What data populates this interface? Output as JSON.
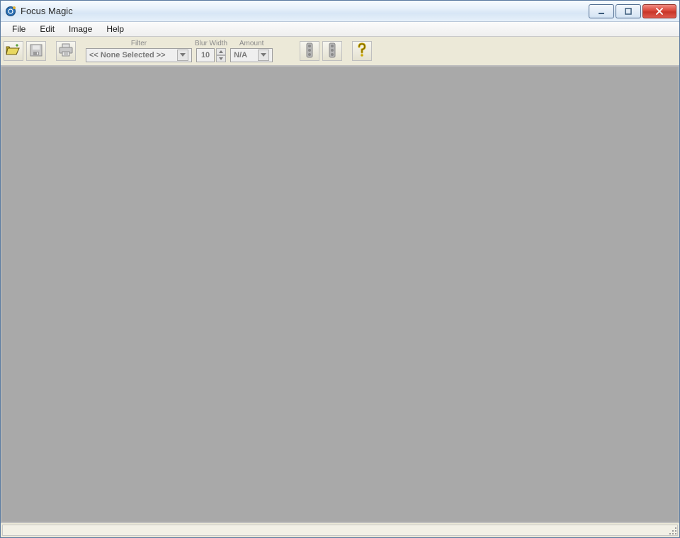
{
  "window": {
    "title": "Focus Magic"
  },
  "menubar": {
    "items": [
      "File",
      "Edit",
      "Image",
      "Help"
    ]
  },
  "toolbar": {
    "filter": {
      "label": "Filter",
      "value": "<< None Selected >>"
    },
    "blur_width": {
      "label": "Blur Width",
      "value": "10"
    },
    "amount": {
      "label": "Amount",
      "value": "N/A"
    }
  },
  "statusbar": {
    "text": ""
  },
  "icons": {
    "open": "open-folder-icon",
    "save": "save-icon",
    "print": "print-icon",
    "traffic1": "traffic-light-icon",
    "traffic2": "traffic-light-icon",
    "help": "help-icon"
  }
}
